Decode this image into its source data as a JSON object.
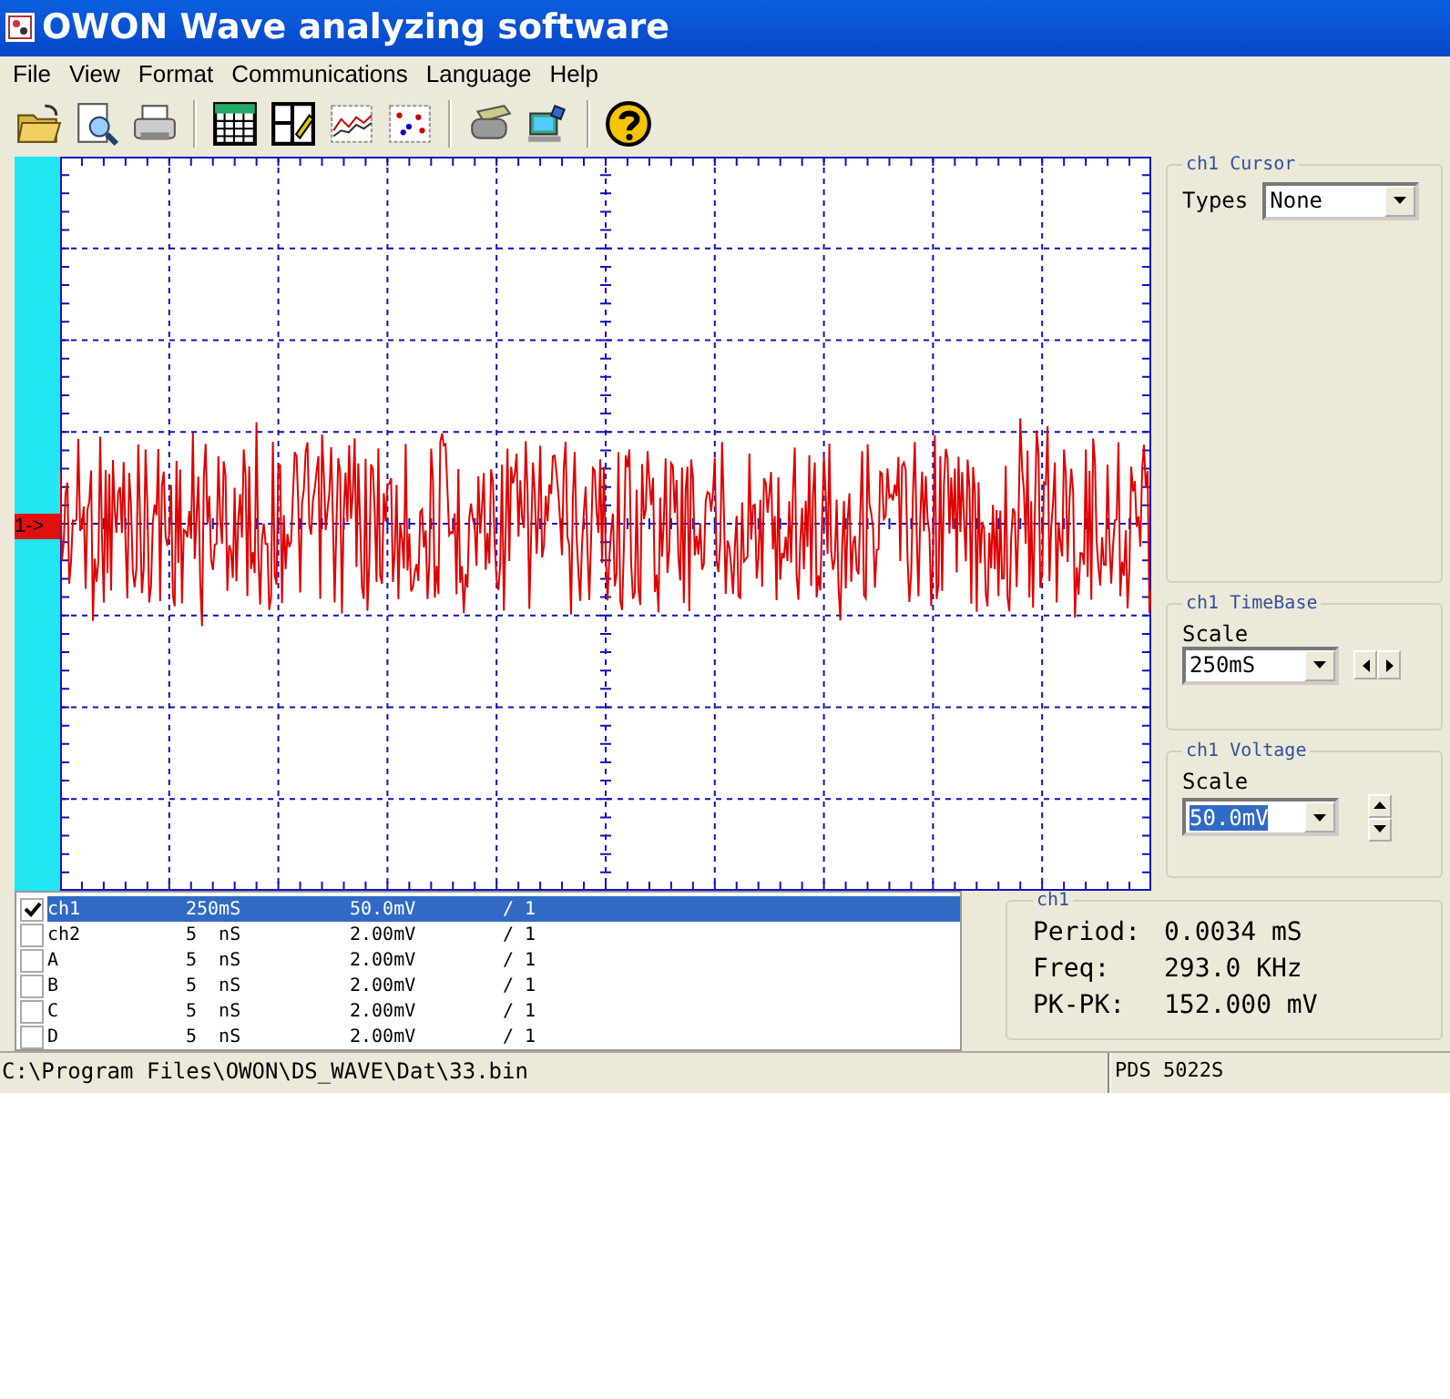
{
  "window": {
    "title": "OWON Wave analyzing software"
  },
  "menu": [
    {
      "label": "File"
    },
    {
      "label": "View"
    },
    {
      "label": "Format"
    },
    {
      "label": "Communications"
    },
    {
      "label": "Language"
    },
    {
      "label": "Help"
    }
  ],
  "scope": {
    "channel_marker": "1->"
  },
  "cursor_panel": {
    "title": "ch1 Cursor",
    "types_label": "Types",
    "types_value": "None"
  },
  "timebase_panel": {
    "title": "ch1 TimeBase",
    "scale_label": "Scale",
    "scale_value": "250mS"
  },
  "voltage_panel": {
    "title": "ch1 Voltage",
    "scale_label": "Scale",
    "scale_value": "50.0mV",
    "value_highlighted": true
  },
  "channels": [
    {
      "name": "ch1",
      "timebase": "250mS",
      "voltage": "50.0mV",
      "ratio": "/ 1",
      "checked": true,
      "selected": true
    },
    {
      "name": "ch2",
      "timebase": "5  nS",
      "voltage": "2.00mV",
      "ratio": "/ 1",
      "checked": false,
      "selected": false
    },
    {
      "name": "A",
      "timebase": "5  nS",
      "voltage": "2.00mV",
      "ratio": "/ 1",
      "checked": false,
      "selected": false
    },
    {
      "name": "B",
      "timebase": "5  nS",
      "voltage": "2.00mV",
      "ratio": "/ 1",
      "checked": false,
      "selected": false
    },
    {
      "name": "C",
      "timebase": "5  nS",
      "voltage": "2.00mV",
      "ratio": "/ 1",
      "checked": false,
      "selected": false
    },
    {
      "name": "D",
      "timebase": "5  nS",
      "voltage": "2.00mV",
      "ratio": "/ 1",
      "checked": false,
      "selected": false
    }
  ],
  "measurements": {
    "title": "ch1",
    "rows": [
      {
        "label": "Period:",
        "value": "0.0034 mS"
      },
      {
        "label": "Freq:",
        "value": "293.0 KHz"
      },
      {
        "label": "PK-PK:",
        "value": "152.000 mV"
      }
    ]
  },
  "status_bar": {
    "path": "C:\\Program Files\\OWON\\DS_WAVE\\Dat\\33.bin",
    "device": "PDS 5022S"
  }
}
